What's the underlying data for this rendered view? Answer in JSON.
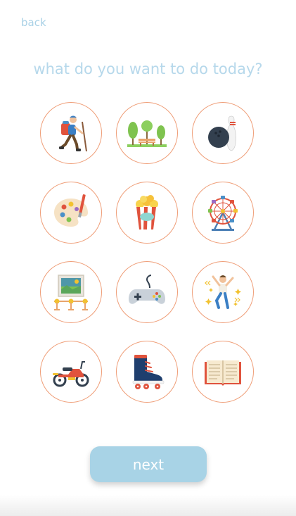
{
  "nav": {
    "back_label": "back"
  },
  "title": "what do you want to do today?",
  "activities": [
    {
      "icon": "hiking-icon"
    },
    {
      "icon": "park-icon"
    },
    {
      "icon": "bowling-icon"
    },
    {
      "icon": "painting-icon"
    },
    {
      "icon": "popcorn-icon"
    },
    {
      "icon": "ferris-wheel-icon"
    },
    {
      "icon": "art-gallery-icon"
    },
    {
      "icon": "gamepad-icon"
    },
    {
      "icon": "dancing-icon"
    },
    {
      "icon": "motorbike-icon"
    },
    {
      "icon": "roller-skate-icon"
    },
    {
      "icon": "book-icon"
    }
  ],
  "next_label": "next",
  "colors": {
    "accent": "#a8d3e6",
    "title": "#b6d8eb",
    "circle_border": "#ef9e78"
  }
}
